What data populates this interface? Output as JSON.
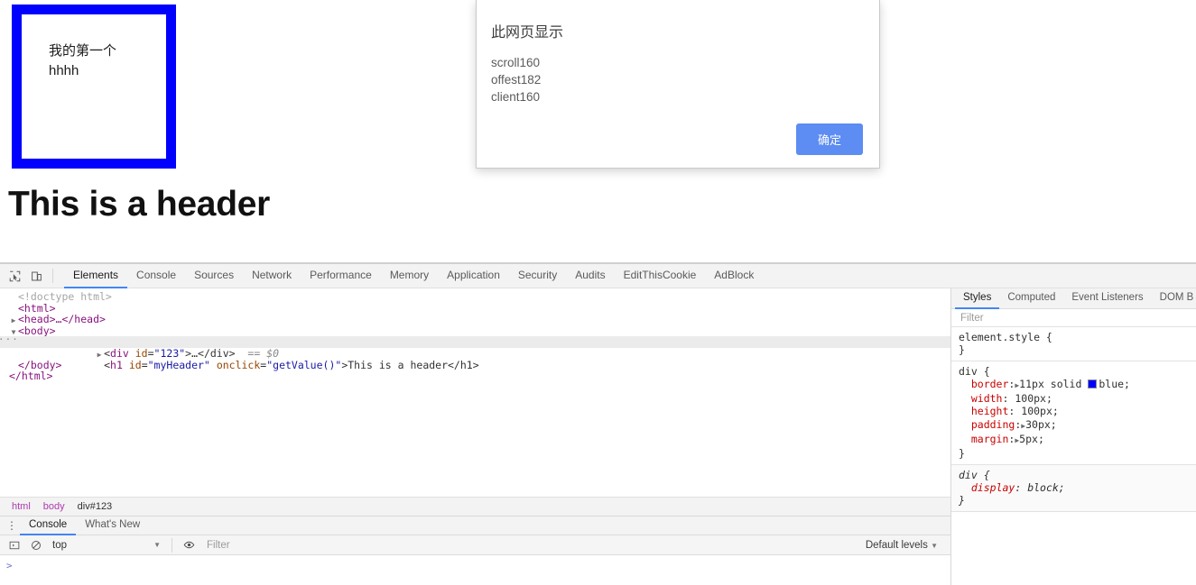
{
  "page": {
    "div_text_line1": "我的第一个",
    "div_text_line2": "hhhh",
    "header": "This is a header"
  },
  "dialog": {
    "title": "此网页显示",
    "lines": [
      "scroll160",
      "offest182",
      "client160"
    ],
    "ok_label": "确定",
    "accent_color": "#5d8cf2"
  },
  "devtools": {
    "tabs": [
      {
        "label": "Elements",
        "active": true
      },
      {
        "label": "Console",
        "active": false
      },
      {
        "label": "Sources",
        "active": false
      },
      {
        "label": "Network",
        "active": false
      },
      {
        "label": "Performance",
        "active": false
      },
      {
        "label": "Memory",
        "active": false
      },
      {
        "label": "Application",
        "active": false
      },
      {
        "label": "Security",
        "active": false
      },
      {
        "label": "Audits",
        "active": false
      },
      {
        "label": "EditThisCookie",
        "active": false
      },
      {
        "label": "AdBlock",
        "active": false
      }
    ],
    "icons": {
      "inspect": "inspect-element-icon",
      "device": "device-toolbar-icon"
    },
    "dom": {
      "l1_doctype": "<!doctype html>",
      "l2_html_open": "<html>",
      "l3_head": "<head>…</head>",
      "l4_body_open": "<body>",
      "l5_div_tag": "div",
      "l5_div_attr": "id",
      "l5_div_val": "\"123\"",
      "l5_div_rest": ">…</div>",
      "l5_selected_marker": "== $0",
      "l6_h1_tag": "h1",
      "l6_h1_attr1": "id",
      "l6_h1_val1": "\"myHeader\"",
      "l6_h1_attr2": "onclick",
      "l6_h1_val2": "\"getValue()\"",
      "l6_h1_text": ">This is a header</h1>",
      "l7_body_close": "</body>",
      "l8_html_close": "</html>"
    },
    "breadcrumb": [
      "html",
      "body",
      "div#123"
    ],
    "drawer": {
      "tabs": [
        {
          "label": "Console",
          "active": true
        },
        {
          "label": "What's New",
          "active": false
        }
      ],
      "context": "top",
      "filter_placeholder": "Filter",
      "levels_label": "Default levels",
      "prompt": ">"
    },
    "styles": {
      "tabs": [
        {
          "label": "Styles",
          "active": true
        },
        {
          "label": "Computed",
          "active": false
        },
        {
          "label": "Event Listeners",
          "active": false
        },
        {
          "label": "DOM B",
          "active": false
        }
      ],
      "filter_placeholder": "Filter",
      "rules": [
        {
          "selector": "element.style {",
          "close": "}",
          "declarations": []
        },
        {
          "selector": "div {",
          "close": "}",
          "declarations": [
            {
              "prop": "border",
              "expand": true,
              "value": "11px solid ",
              "swatch": "#0000ff",
              "value_tail": "blue;"
            },
            {
              "prop": "width",
              "expand": false,
              "value": "100px;"
            },
            {
              "prop": "height",
              "expand": false,
              "value": "100px;"
            },
            {
              "prop": "padding",
              "expand": true,
              "value": "30px;"
            },
            {
              "prop": "margin",
              "expand": true,
              "value": "5px;"
            }
          ]
        },
        {
          "selector": "div {",
          "close": "}",
          "ua": true,
          "declarations": [
            {
              "prop": "display",
              "expand": false,
              "value": "block;"
            }
          ]
        }
      ]
    }
  }
}
